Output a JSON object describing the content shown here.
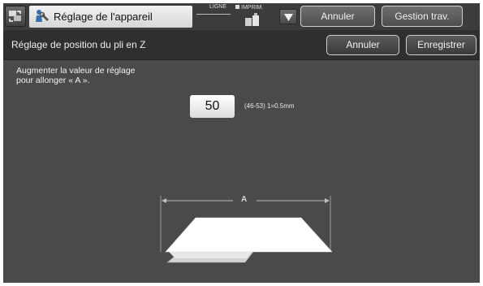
{
  "topbar": {
    "title": "Réglage de l'appareil",
    "status_ligne": "LIGNE",
    "status_imprim": "IMPRIM.",
    "cancel_label": "Annuler",
    "job_label": "Gestion trav."
  },
  "subbar": {
    "title": "Réglage de position du pli en Z",
    "cancel_label": "Annuler",
    "save_label": "Enregistrer"
  },
  "content": {
    "instruction_line1": "Augmenter la valeur de réglage",
    "instruction_line2": "pour allonger « A ».",
    "value": "50",
    "range_hint": "(46-53) 1=0.5mm",
    "dimension_label": "A"
  }
}
